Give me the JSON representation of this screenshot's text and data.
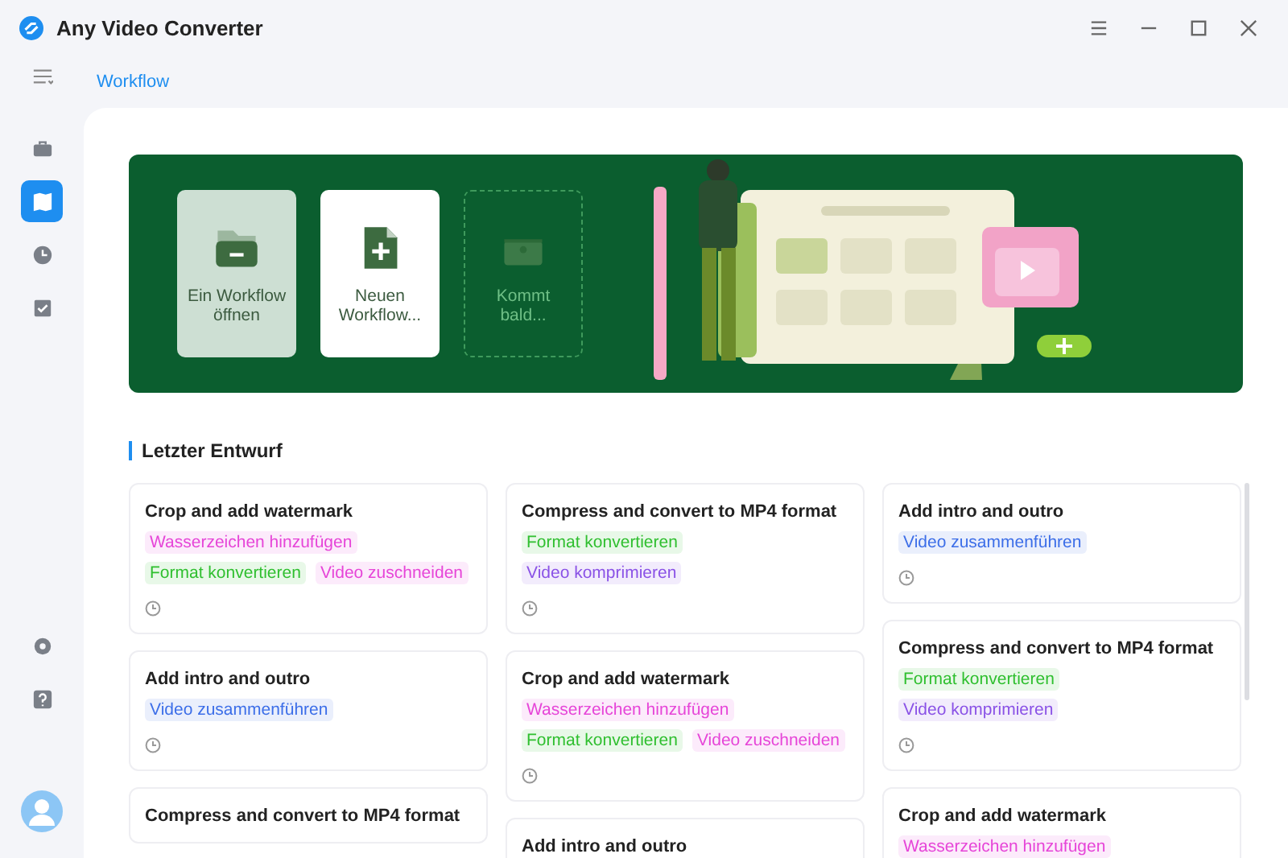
{
  "window": {
    "title": "Any Video Converter"
  },
  "sidebar": {
    "items": [
      {
        "kind": "toolbox",
        "selected": false
      },
      {
        "kind": "workflow",
        "selected": true
      },
      {
        "kind": "history",
        "selected": false
      },
      {
        "kind": "tasks",
        "selected": false
      }
    ],
    "bottom_items": [
      {
        "kind": "settings"
      },
      {
        "kind": "help"
      },
      {
        "kind": "avatar"
      }
    ]
  },
  "tabs": [
    {
      "label": "Workflow",
      "selected": true
    }
  ],
  "banner": {
    "actions": [
      {
        "kind": "open",
        "label": "Ein Workflow öffnen",
        "disabled": false
      },
      {
        "kind": "new",
        "label": "Neuen Workflow...",
        "disabled": false
      },
      {
        "kind": "soon",
        "label": "Kommt bald...",
        "disabled": true
      }
    ]
  },
  "section": {
    "title": "Letzter Entwurf"
  },
  "columns": [
    {
      "cards": [
        {
          "title": "Crop and add watermark",
          "tags": [
            {
              "label": "Wasserzeichen hinzufügen",
              "color": "#e645d8"
            },
            {
              "label": "Format konvertieren",
              "color": "#2fbf2f"
            },
            {
              "label": "Video zuschneiden",
              "color": "#e645d8"
            }
          ],
          "clock": true
        },
        {
          "title": "Add intro and outro",
          "tags": [
            {
              "label": "Video zusammenführen",
              "color": "#3c6ee8"
            }
          ],
          "clock": true
        },
        {
          "title": "Compress and convert to MP4 format",
          "clock": false
        }
      ]
    },
    {
      "cards": [
        {
          "title": "Compress and convert to MP4 format",
          "tags": [
            {
              "label": "Format konvertieren",
              "color": "#2fbf2f"
            },
            {
              "label": "Video komprimieren",
              "color": "#8a52e6"
            }
          ],
          "clock": true
        },
        {
          "title": "Crop and add watermark",
          "tags": [
            {
              "label": "Wasserzeichen hinzufügen",
              "color": "#e645d8"
            },
            {
              "label": "Format konvertieren",
              "color": "#2fbf2f"
            },
            {
              "label": "Video zuschneiden",
              "color": "#e645d8"
            }
          ],
          "clock": true
        },
        {
          "title": "Add intro and outro",
          "clock": false
        }
      ]
    },
    {
      "cards": [
        {
          "title": "Add intro and outro",
          "tags": [
            {
              "label": "Video zusammenführen",
              "color": "#3c6ee8"
            }
          ],
          "clock": true
        },
        {
          "title": "Compress and convert to MP4 format",
          "tags": [
            {
              "label": "Format konvertieren",
              "color": "#2fbf2f"
            },
            {
              "label": "Video komprimieren",
              "color": "#8a52e6"
            }
          ],
          "clock": true
        },
        {
          "title": "Crop and add watermark",
          "tags": [
            {
              "label": "Wasserzeichen hinzufügen",
              "color": "#e645d8"
            }
          ],
          "clock": false
        }
      ]
    }
  ]
}
